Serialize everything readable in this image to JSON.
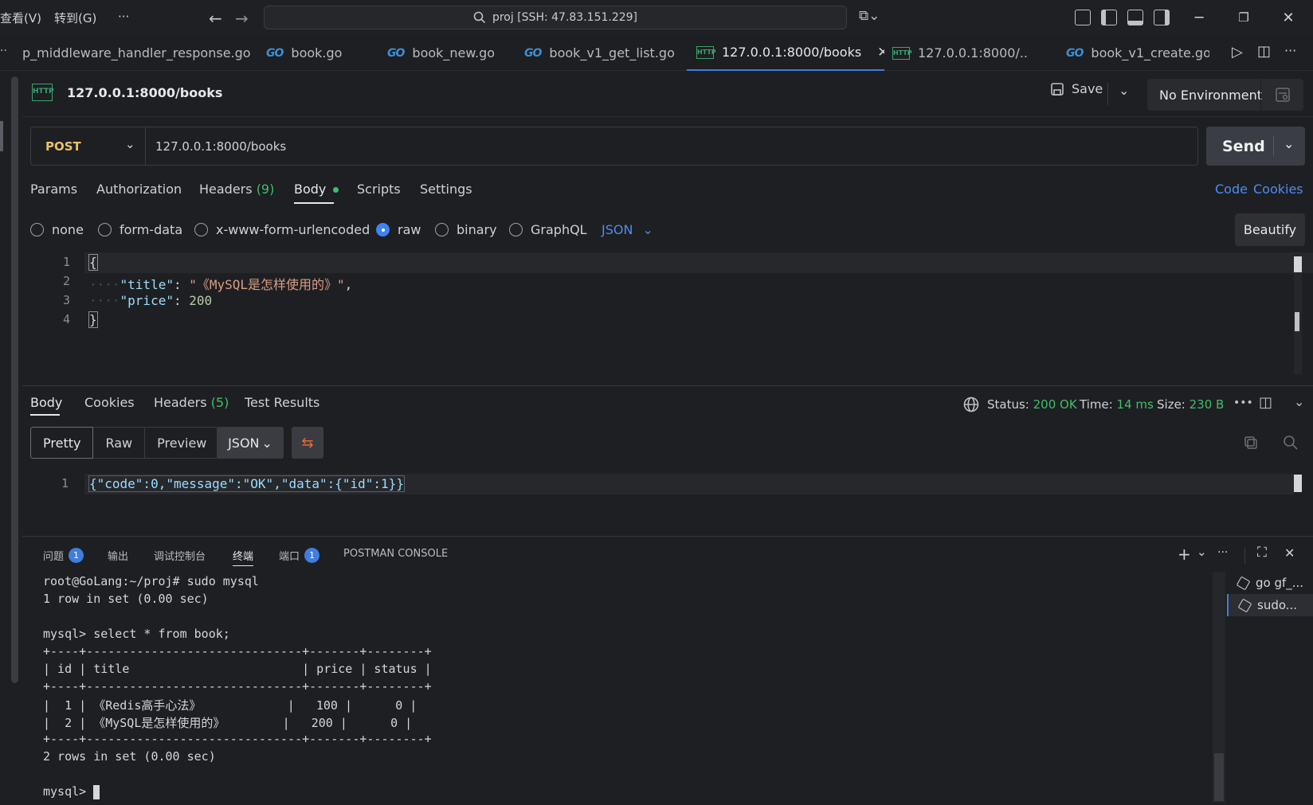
{
  "menu": {
    "view": "查看(V)",
    "goto": "转到(G)",
    "more": "···"
  },
  "command_center": {
    "text": "proj [SSH: 47.83.151.229]"
  },
  "tabs": [
    {
      "label": "p_middleware_handler_response.go",
      "type": "go"
    },
    {
      "label": "book.go",
      "type": "go"
    },
    {
      "label": "book_new.go",
      "type": "go"
    },
    {
      "label": "book_v1_get_list.go",
      "type": "go"
    },
    {
      "label": "127.0.0.1:8000/books",
      "type": "http",
      "active": true
    },
    {
      "label": "127.0.0.1:8000/...",
      "type": "http"
    },
    {
      "label": "book_v1_create.go",
      "type": "go"
    }
  ],
  "request": {
    "title": "127.0.0.1:8000/books",
    "save_label": "Save",
    "environment": "No Environment",
    "method": "POST",
    "url": "127.0.0.1:8000/books",
    "send_label": "Send",
    "tabs": {
      "params": "Params",
      "authorization": "Authorization",
      "headers": "Headers",
      "headers_count": "(9)",
      "body": "Body",
      "scripts": "Scripts",
      "settings": "Settings"
    },
    "code_link": "Code",
    "cookies_link": "Cookies",
    "body_modes": [
      "none",
      "form-data",
      "x-www-form-urlencoded",
      "raw",
      "binary",
      "GraphQL"
    ],
    "selected_mode": "raw",
    "format": "JSON",
    "beautify_label": "Beautify",
    "body_lines": [
      {
        "num": "1",
        "text": "{"
      },
      {
        "num": "2",
        "key": "\"title\"",
        "sep": ": ",
        "value": "\"《MySQL是怎样使用的》\"",
        "end": ","
      },
      {
        "num": "3",
        "key": "\"price\"",
        "sep": ": ",
        "value": "200",
        "end": ""
      },
      {
        "num": "4",
        "text": "}"
      }
    ]
  },
  "response": {
    "tabs": {
      "body": "Body",
      "cookies": "Cookies",
      "headers": "Headers",
      "headers_count": "(5)",
      "test_results": "Test Results"
    },
    "status_label": "Status:",
    "status_value": "200 OK",
    "time_label": "Time:",
    "time_value": "14 ms",
    "size_label": "Size:",
    "size_value": "230 B",
    "view_modes": [
      "Pretty",
      "Raw",
      "Preview"
    ],
    "format": "JSON",
    "line_num": "1",
    "body_text": "{\"code\":0,\"message\":\"OK\",\"data\":{\"id\":1}}"
  },
  "panel": {
    "tabs": {
      "problems": "问题",
      "problems_count": "1",
      "output": "输出",
      "debug_console": "调试控制台",
      "terminal": "终端",
      "ports": "端口",
      "ports_count": "1",
      "postman_console": "POSTMAN CONSOLE"
    },
    "terminal_lines": [
      "root@GoLang:~/proj# sudo mysql",
      "1 row in set (0.00 sec)",
      "",
      "mysql> select * from book;",
      "+----+------------------------------+-------+--------+",
      "| id | title                        | price | status |",
      "+----+------------------------------+-------+--------+",
      "|  1 | 《Redis高手心法》            |   100 |      0 |",
      "|  2 | 《MySQL是怎样使用的》        |   200 |      0 |",
      "+----+------------------------------+-------+--------+",
      "2 rows in set (0.00 sec)",
      "",
      "mysql> "
    ],
    "terminals": [
      {
        "label": "go gf_..."
      },
      {
        "label": "sudo..."
      }
    ]
  },
  "colors": {
    "accent": "#3f7ee0",
    "ok": "#3fbf6a",
    "string": "#d69d85",
    "key": "#9cdcfe",
    "number": "#b5cea8"
  }
}
